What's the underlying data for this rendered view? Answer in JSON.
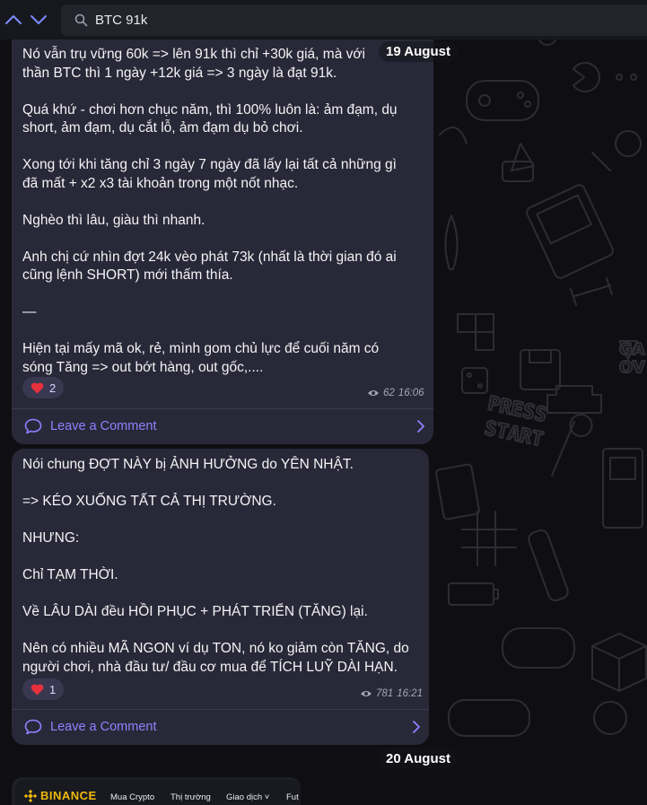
{
  "toolbar": {
    "back_icon": "chevron-up-icon",
    "forward_icon": "chevron-down-icon",
    "search_icon": "search-icon",
    "search_value": "BTC 91k"
  },
  "dates": {
    "first": "19 August",
    "second": "20 August"
  },
  "messages": [
    {
      "lines": [
        "Nó vẫn trụ vững 60k => lên 91k thì chỉ +30k giá, mà với",
        "thần BTC thì 1 ngày +12k giá => 3 ngày là đạt 91k.",
        "",
        "Quá khứ - chơi hơn chục năm, thì 100% luôn là: ảm đạm, dụ",
        "short, ảm đạm, dụ cắt lỗ, ảm đạm dụ bỏ chơi.",
        "",
        "Xong tới khi tăng chỉ 3 ngày 7 ngày đã lấy lại tất cả những gì",
        "đã mất + x2 x3 tài khoản trong một nốt nhạc.",
        "",
        "Nghèo thì lâu, giàu thì nhanh.",
        "",
        "Anh chị cứ nhìn đợt 24k vèo phát 73k (nhất là thời gian đó ai",
        "cũng lệnh SHORT) mới thấm thía.",
        "",
        "—",
        "",
        "Hiện tại mấy mã ok, rẻ, mình gom chủ lực để cuối năm có",
        "sóng Tăng => out bớt hàng, out gốc,...."
      ],
      "reaction": {
        "emoji": "heart-icon",
        "count": "2"
      },
      "views": "62",
      "time": "16:06",
      "comment_label": "Leave a Comment"
    },
    {
      "lines": [
        "Nói chung ĐỢT NÀY bị ẢNH HƯỞNG do YÊN NHẬT.",
        "",
        "=> KÉO XUỐNG TẤT CẢ THỊ TRƯỜNG.",
        "",
        "NHƯNG:",
        "",
        "Chỉ TẠM THỜI.",
        "",
        "Về LÂU DÀI đều HỒI PHỤC + PHÁT TRIỂN (TĂNG) lại.",
        "",
        "Nên có nhiều MÃ NGON ví dụ TON, nó ko giảm còn TĂNG, do",
        "người chơi, nhà đầu tư/ đầu cơ mua để TÍCH LUỸ DÀI HẠN."
      ],
      "reaction": {
        "emoji": "heart-icon",
        "count": "1"
      },
      "views": "781",
      "time": "16:21",
      "comment_label": "Leave a Comment"
    }
  ],
  "next_post": {
    "brand": "BINANCE",
    "nav": [
      "Mua Crypto",
      "Thị trường",
      "Giao dịch",
      "Fut"
    ]
  },
  "colors": {
    "bubble": "#292838",
    "accent": "#8c82ff",
    "heart": "#e8303d",
    "binance": "#f0b90b"
  }
}
